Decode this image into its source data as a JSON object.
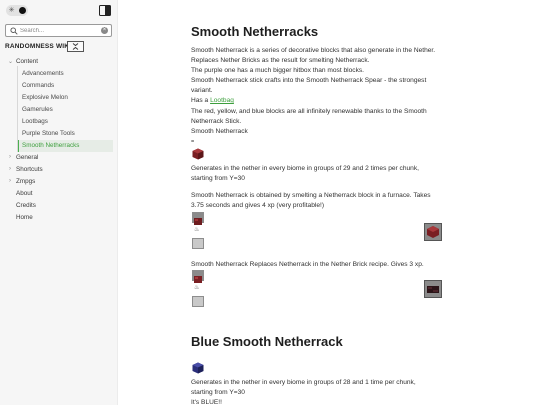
{
  "sidebar": {
    "search": {
      "placeholder": "Search..."
    },
    "site_title": "RANDOMNESS WIKI",
    "nav": {
      "content": "Content",
      "children": [
        "Advancements",
        "Commands",
        "Explosive Melon",
        "Gamerules",
        "Lootbags",
        "Purple Stone Tools",
        "Smooth Netherracks"
      ],
      "active": "Smooth Netherracks",
      "general": "General",
      "shortcuts": "Shortcuts",
      "zmpgs": "Zmpgs",
      "about": "About",
      "credits": "Credits",
      "home": "Home"
    }
  },
  "page": {
    "title": "Smooth Netherracks",
    "intro": [
      "Smooth Netherrack is a series of decorative blocks that also generate in the Nether.",
      "Replaces Nether Bricks as the result for smelting Netherrack.",
      "The purple one has a much bigger hitbox than most blocks.",
      "Smooth Netherrack stick crafts into the Smooth Netherrack Spear - the strongest",
      "variant."
    ],
    "has_a": "Has a ",
    "lootbag_link": "Lootbag",
    "renewable": [
      "The red, yellow, and blue blocks are all infinitely renewable thanks to the Smooth",
      "Netherrack Stick."
    ],
    "block_name": "Smooth Netherrack",
    "equals": "=",
    "generation": [
      "Generates in the nether in every biome in groups of 29 and 2 times per chunk,",
      "starting from Y=30"
    ],
    "obtained": [
      "Smooth Netherrack is obtained by smelting a Netherrack block in a furnace. Takes",
      "3.75 seconds and gives 4 xp (very profitable!)"
    ],
    "replaces": "Smooth Netherrack Replaces Netherrack in the Nether Brick recipe. Gives 3 xp.",
    "blue_title": "Blue Smooth Netherrack",
    "blue_generation": [
      "Generates in the nether in every biome in groups of 28 and 1 time per chunk,",
      "starting from Y=30"
    ],
    "blue_note": "It's BLUE!!"
  },
  "colors": {
    "accent": "#4caf50",
    "link": "#3d9f3d",
    "red_block": "#7a1f23",
    "blue_block": "#2b2f7a"
  },
  "icons": [
    "sun-icon",
    "layout-icon",
    "search-icon",
    "clear-icon",
    "collapse-icon",
    "chevron-down-icon",
    "chevron-right-icon",
    "flame-icon"
  ]
}
